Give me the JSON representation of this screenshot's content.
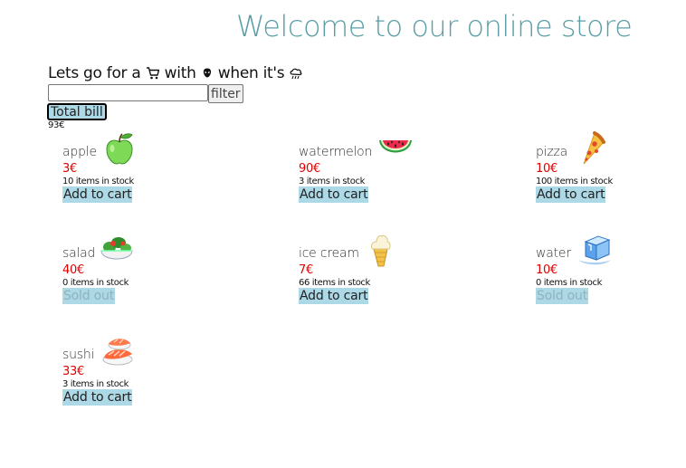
{
  "header": {
    "title": "Welcome to our online store",
    "tagline_part1": "Lets go for a",
    "tagline_part2": "with",
    "tagline_part3": "when it's"
  },
  "filter": {
    "input_value": "",
    "button_label": "filter"
  },
  "bill": {
    "button_label": "Total bill",
    "total": "93€"
  },
  "products": [
    {
      "name": "apple",
      "price": "3€",
      "stock": "10 items in stock",
      "button": "Add to cart",
      "available": true,
      "icon": "green-apple-icon"
    },
    {
      "name": "watermelon",
      "price": "90€",
      "stock": "3 items in stock",
      "button": "Add to cart",
      "available": true,
      "icon": "watermelon-icon"
    },
    {
      "name": "pizza",
      "price": "10€",
      "stock": "100 items in stock",
      "button": "Add to cart",
      "available": true,
      "icon": "pizza-icon"
    },
    {
      "name": "salad",
      "price": "40€",
      "stock": "0 items in stock",
      "button": "Sold out",
      "available": false,
      "icon": "salad-icon"
    },
    {
      "name": "ice cream",
      "price": "7€",
      "stock": "66 items in stock",
      "button": "Add to cart",
      "available": true,
      "icon": "ice-cream-icon"
    },
    {
      "name": "water",
      "price": "10€",
      "stock": "0 items in stock",
      "button": "Sold out",
      "available": false,
      "icon": "ice-cube-icon"
    },
    {
      "name": "sushi",
      "price": "33€",
      "stock": "3 items in stock",
      "button": "Add to cart",
      "available": true,
      "icon": "sushi-icon"
    }
  ],
  "colors": {
    "title": "#5b9ea6",
    "price": "#e00000",
    "button_bg": "#add8e6",
    "disabled_text": "#8fb3bd"
  }
}
